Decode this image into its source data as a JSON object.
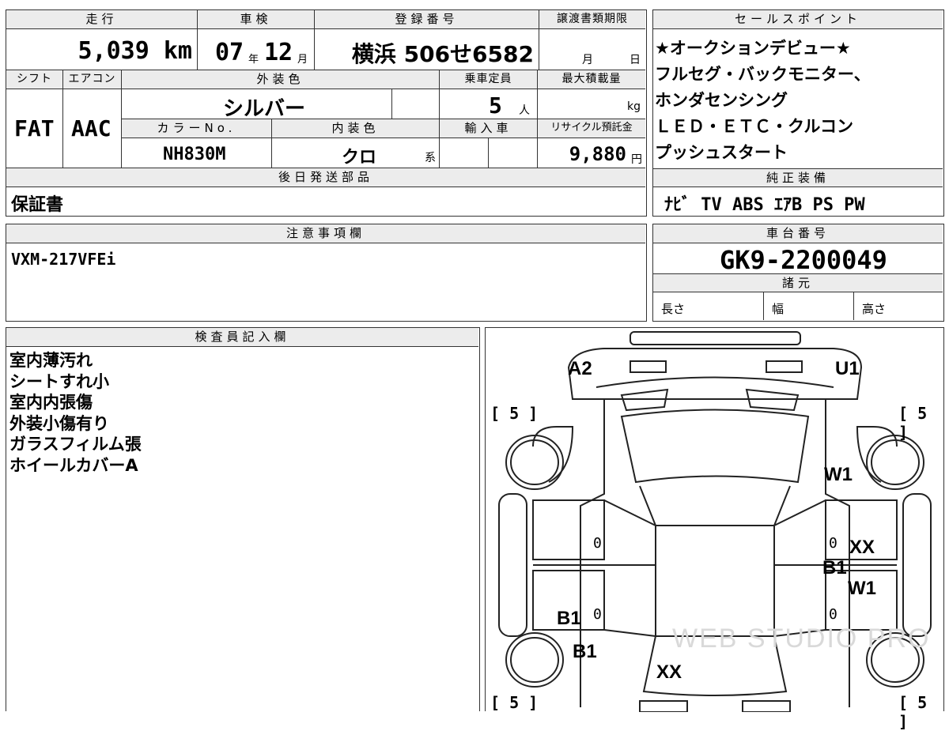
{
  "top_info": {
    "labels": {
      "mileage": "走行",
      "shaken": "車検",
      "registration": "登録番号",
      "transfer_deadline": "譲渡書類期限",
      "shift": "シフト",
      "aircon": "エアコン",
      "exterior_color": "外装色",
      "capacity": "乗車定員",
      "max_load": "最大積載量",
      "color_no": "カラーNo.",
      "interior_color": "内装色",
      "import": "輸入車",
      "recycle": "リサイクル預託金",
      "later_parts": "後日発送部品"
    },
    "mileage_value": "5,039 km",
    "shaken_year": "07",
    "shaken_year_unit": "年",
    "shaken_month": "12",
    "shaken_month_unit": "月",
    "registration_value": "横浜 506せ6582",
    "deadline_month": "月",
    "deadline_day": "日",
    "shift_value": "FAT",
    "aircon_value": "AAC",
    "exterior_color_value": "シルバー",
    "capacity_value": "5",
    "capacity_unit": "人",
    "max_load_unit": "kg",
    "color_no_value": "NH830M",
    "interior_color_value": "クロ",
    "interior_suffix": "系",
    "recycle_value": "9,880",
    "recycle_unit": "円",
    "later_parts_value": "保証書"
  },
  "sales_points": {
    "header": "セールスポイント",
    "lines": [
      "★オークションデビュー★",
      "フルセグ・バックモニター、",
      "ホンダセンシング",
      "ＬＥＤ・ＥＴＣ・クルコン",
      "プッシュスタート"
    ]
  },
  "genuine_equipment": {
    "header": "純正装備",
    "value": "ﾅﾋﾞ TV ABS ｴｱB PS PW"
  },
  "notes": {
    "header": "注意事項欄",
    "value": "VXM-217VFEi"
  },
  "chassis": {
    "header": "車台番号",
    "value": "GK9-2200049",
    "spec_header": "諸元",
    "length": "長さ",
    "width": "幅",
    "height": "高さ"
  },
  "inspector": {
    "header": "検査員記入欄",
    "lines": [
      "室内薄汚れ",
      "シートすれ小",
      "室内内張傷",
      "外装小傷有り",
      "ガラスフィルム張",
      "ホイールカバーA"
    ]
  },
  "diagram": {
    "marks": {
      "a2": "A2",
      "u1": "U1",
      "w1_upper": "W1",
      "xx_right": "XX",
      "b1_right": "B1",
      "w1_right": "W1",
      "b1_left_a": "B1",
      "b1_left_b": "B1",
      "xx_rear": "XX"
    },
    "tire_labels": {
      "front_left": "[ 5 ]",
      "front_right": "[ 5 ]",
      "rear_left": "[ 5 ]",
      "rear_right": "[ 5 ]"
    },
    "zeros": {
      "z1": "0",
      "z2": "0",
      "z3": "0",
      "z4": "0"
    },
    "watermark": "WEB STUDIO PRO"
  }
}
